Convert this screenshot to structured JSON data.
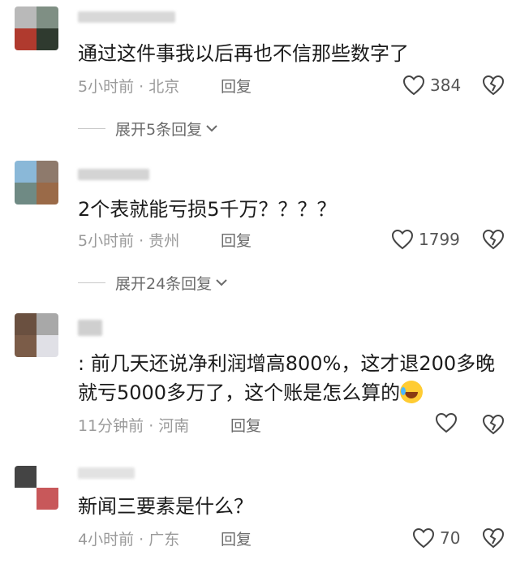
{
  "comments": [
    {
      "text": "通过这件事我以后再也不信那些数字了",
      "time": "5小时前 · 北京",
      "reply": "回复",
      "likes": "384",
      "expand": "展开5条回复",
      "avatar_colors": [
        "#b9b9b9",
        "#7f8f84",
        "#b03a2e",
        "#2f3a2f"
      ]
    },
    {
      "text": "2个表就能亏损5千万？？？？",
      "time": "5小时前 · 贵州",
      "reply": "回复",
      "likes": "1799",
      "expand": "展开24条回复",
      "avatar_colors": [
        "#8ab8d8",
        "#8e7a6c",
        "#6f8a84",
        "#9a6a48"
      ]
    },
    {
      "text": ": 前几天还说净利润增高800%，这才退200多晚就亏5000多万了，这个账是怎么算的",
      "time": "11分钟前 · 河南",
      "reply": "回复",
      "likes": "",
      "avatar_colors": [
        "#6a5040",
        "#a8a8a8",
        "#7b5c48",
        "#e0e0e6"
      ]
    },
    {
      "text": "新闻三要素是什么？",
      "time": "4小时前 · 广东",
      "reply": "回复",
      "likes": "70",
      "avatar_colors": [
        "#444444",
        "#ffffff",
        "#ffffff",
        "#c8585a"
      ]
    }
  ],
  "icons": {
    "like": "heart-outline-icon",
    "dislike": "broken-heart-icon",
    "chevron": "chevron-down-icon",
    "emoji": "laughing-tears-emoji"
  }
}
